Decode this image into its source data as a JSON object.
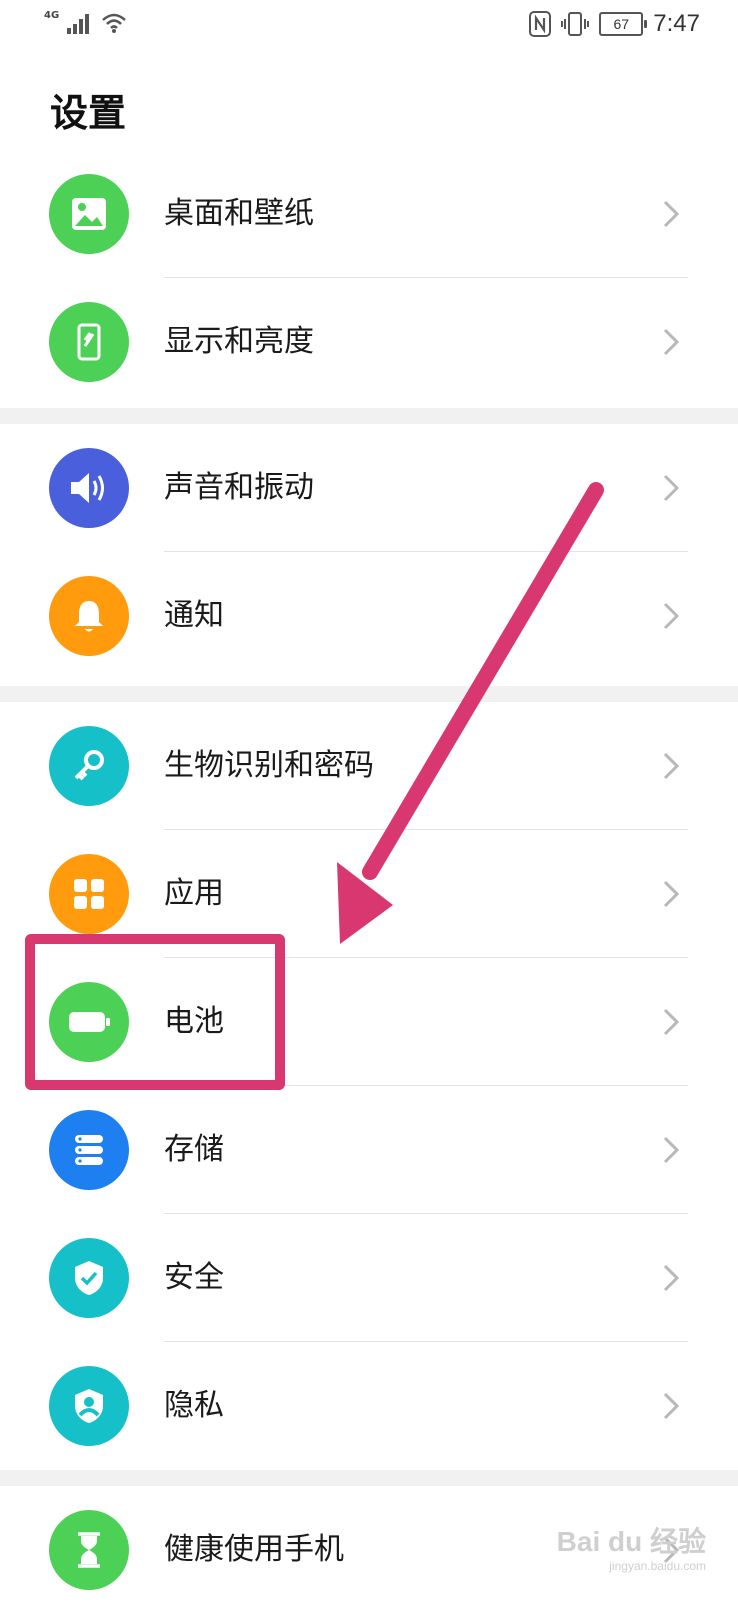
{
  "status_bar": {
    "network": "4G",
    "battery_level": "67",
    "time": "7:47",
    "icons": [
      "signal-icon",
      "wifi-icon",
      "nfc-icon",
      "vibrate-icon",
      "battery-icon"
    ]
  },
  "page": {
    "title": "设置"
  },
  "groups": [
    {
      "items": [
        {
          "label": "桌面和壁纸",
          "icon": "wallpaper-icon",
          "color": "#4cd055"
        },
        {
          "label": "显示和亮度",
          "icon": "display-icon",
          "color": "#4cd055"
        }
      ]
    },
    {
      "items": [
        {
          "label": "声音和振动",
          "icon": "speaker-icon",
          "color": "#4a5fdb"
        },
        {
          "label": "通知",
          "icon": "bell-icon",
          "color": "#ff9b0c"
        }
      ]
    },
    {
      "items": [
        {
          "label": "生物识别和密码",
          "icon": "key-icon",
          "color": "#16c0c9"
        },
        {
          "label": "应用",
          "icon": "apps-grid-icon",
          "color": "#ff9b0c"
        },
        {
          "label": "电池",
          "icon": "battery-icon",
          "color": "#4cd055"
        },
        {
          "label": "存储",
          "icon": "storage-icon",
          "color": "#1d7ff0"
        },
        {
          "label": "安全",
          "icon": "shield-icon",
          "color": "#16c0c9"
        },
        {
          "label": "隐私",
          "icon": "privacy-icon",
          "color": "#16c0c9"
        }
      ]
    },
    {
      "items": [
        {
          "label": "健康使用手机",
          "icon": "hourglass-icon",
          "color": "#4cd055"
        }
      ]
    }
  ],
  "annotation": {
    "highlight_color": "#d9376f",
    "highlighted_item": "电池"
  },
  "watermark": {
    "brand": "Bai du 经验",
    "url": "jingyan.baidu.com"
  }
}
